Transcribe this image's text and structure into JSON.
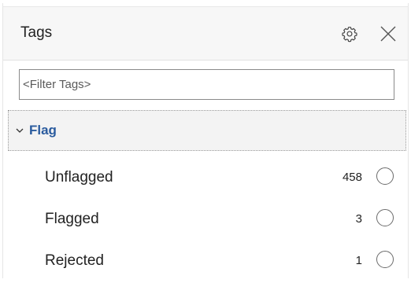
{
  "panel": {
    "title": "Tags",
    "settings_icon": "gear-icon",
    "close_icon": "close-icon"
  },
  "filter": {
    "placeholder": "<Filter Tags>",
    "value": ""
  },
  "group": {
    "label": "Flag",
    "expanded": true,
    "color": "#2a5b9e",
    "items": [
      {
        "label": "Unflagged",
        "count": "458",
        "selected": false
      },
      {
        "label": "Flagged",
        "count": "3",
        "selected": false
      },
      {
        "label": "Rejected",
        "count": "1",
        "selected": false
      }
    ]
  }
}
